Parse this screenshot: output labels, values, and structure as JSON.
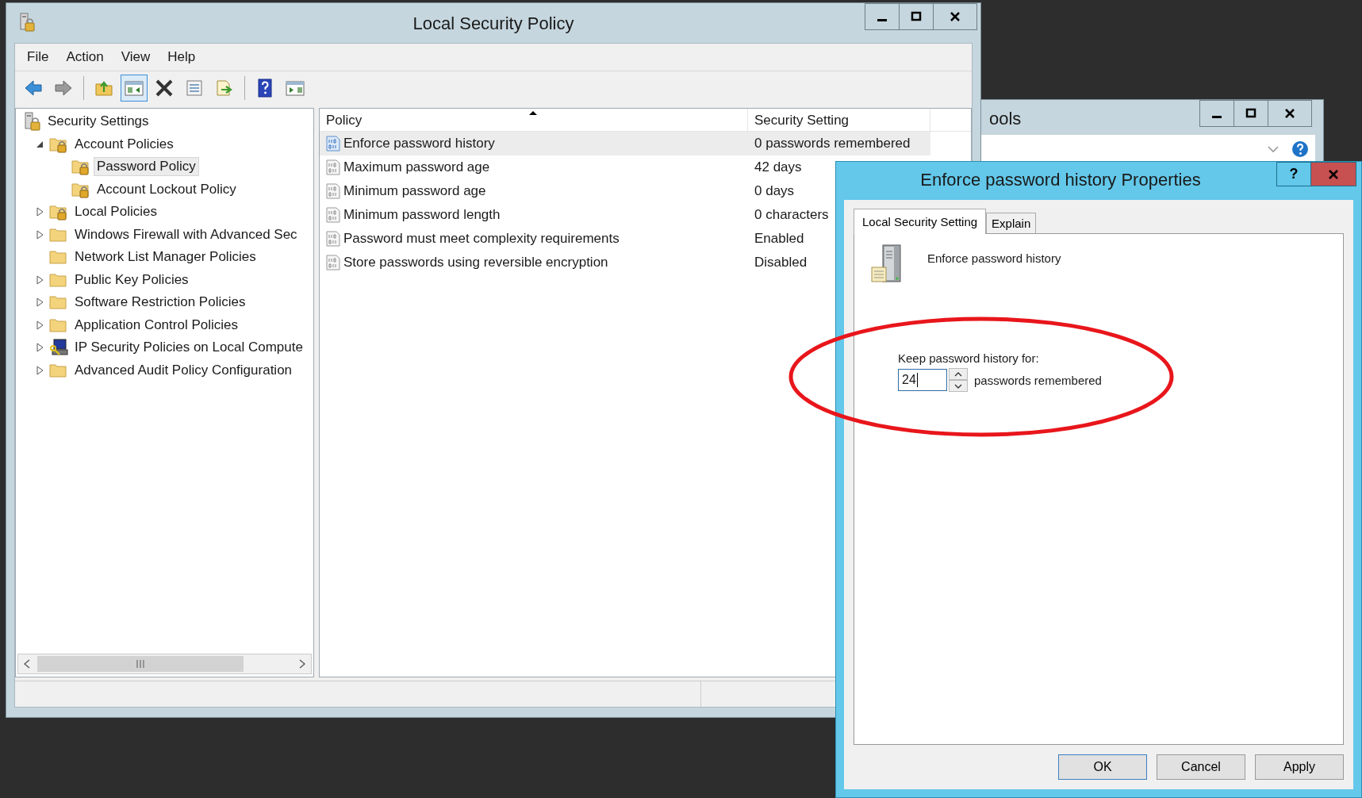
{
  "back_window": {
    "title": "ools"
  },
  "main_window": {
    "title": "Local Security Policy",
    "menu": [
      "File",
      "Action",
      "View",
      "Help"
    ],
    "toolbar": [
      [
        {
          "kind": "back",
          "pressed": false
        },
        {
          "kind": "forward",
          "pressed": false
        }
      ],
      [
        {
          "kind": "up",
          "pressed": false
        },
        {
          "kind": "tree",
          "pressed": true
        },
        {
          "kind": "delete",
          "pressed": false
        },
        {
          "kind": "properties",
          "pressed": false
        },
        {
          "kind": "export",
          "pressed": false
        }
      ],
      [
        {
          "kind": "help",
          "pressed": false
        },
        {
          "kind": "action-pane",
          "pressed": false
        }
      ]
    ],
    "tree": [
      {
        "label": "Security Settings",
        "kind": "security",
        "selected": false,
        "children": [
          {
            "label": "Account Policies",
            "kind": "lockfolder",
            "expanded": true,
            "selected": false,
            "children": [
              {
                "label": "Password Policy",
                "kind": "lockfolder",
                "selected": true
              },
              {
                "label": "Account Lockout Policy",
                "kind": "lockfolder",
                "selected": false
              }
            ]
          },
          {
            "label": "Local Policies",
            "kind": "lockfolder",
            "expanded": false,
            "selected": false
          },
          {
            "label": "Windows Firewall with Advanced Sec",
            "kind": "folder",
            "expanded": false,
            "selected": false
          },
          {
            "label": "Network List Manager Policies",
            "kind": "folder",
            "selected": false
          },
          {
            "label": "Public Key Policies",
            "kind": "folder",
            "expanded": false,
            "selected": false
          },
          {
            "label": "Software Restriction Policies",
            "kind": "folder",
            "expanded": false,
            "selected": false
          },
          {
            "label": "Application Control Policies",
            "kind": "folder",
            "expanded": false,
            "selected": false
          },
          {
            "label": "IP Security Policies on Local Compute",
            "kind": "ipsec",
            "expanded": false,
            "selected": false
          },
          {
            "label": "Advanced Audit Policy Configuration",
            "kind": "folder",
            "expanded": false,
            "selected": false
          }
        ]
      }
    ],
    "table": {
      "columns": [
        {
          "label": "Policy",
          "sorted": true
        },
        {
          "label": "Security Setting"
        }
      ],
      "rows": [
        {
          "policy": "Enforce password history",
          "setting": "0 passwords remembered",
          "selected": true
        },
        {
          "policy": "Maximum password age",
          "setting": "42 days",
          "selected": false
        },
        {
          "policy": "Minimum password age",
          "setting": "0 days",
          "selected": false
        },
        {
          "policy": "Minimum password length",
          "setting": "0 characters",
          "selected": false
        },
        {
          "policy": "Password must meet complexity requirements",
          "setting": "Enabled",
          "selected": false
        },
        {
          "policy": "Store passwords using reversible encryption",
          "setting": "Disabled",
          "selected": false
        }
      ]
    }
  },
  "dialog": {
    "title": "Enforce password history Properties",
    "help_glyph": "?",
    "tabs": [
      {
        "label": "Local Security Setting",
        "selected": true
      },
      {
        "label": "Explain",
        "selected": false
      }
    ],
    "policy_name": "Enforce password history",
    "field_label": "Keep password history for:",
    "value": "24",
    "unit": "passwords remembered",
    "buttons": [
      {
        "label": "OK",
        "default": true
      },
      {
        "label": "Cancel",
        "default": false
      },
      {
        "label": "Apply",
        "default": false
      }
    ]
  }
}
